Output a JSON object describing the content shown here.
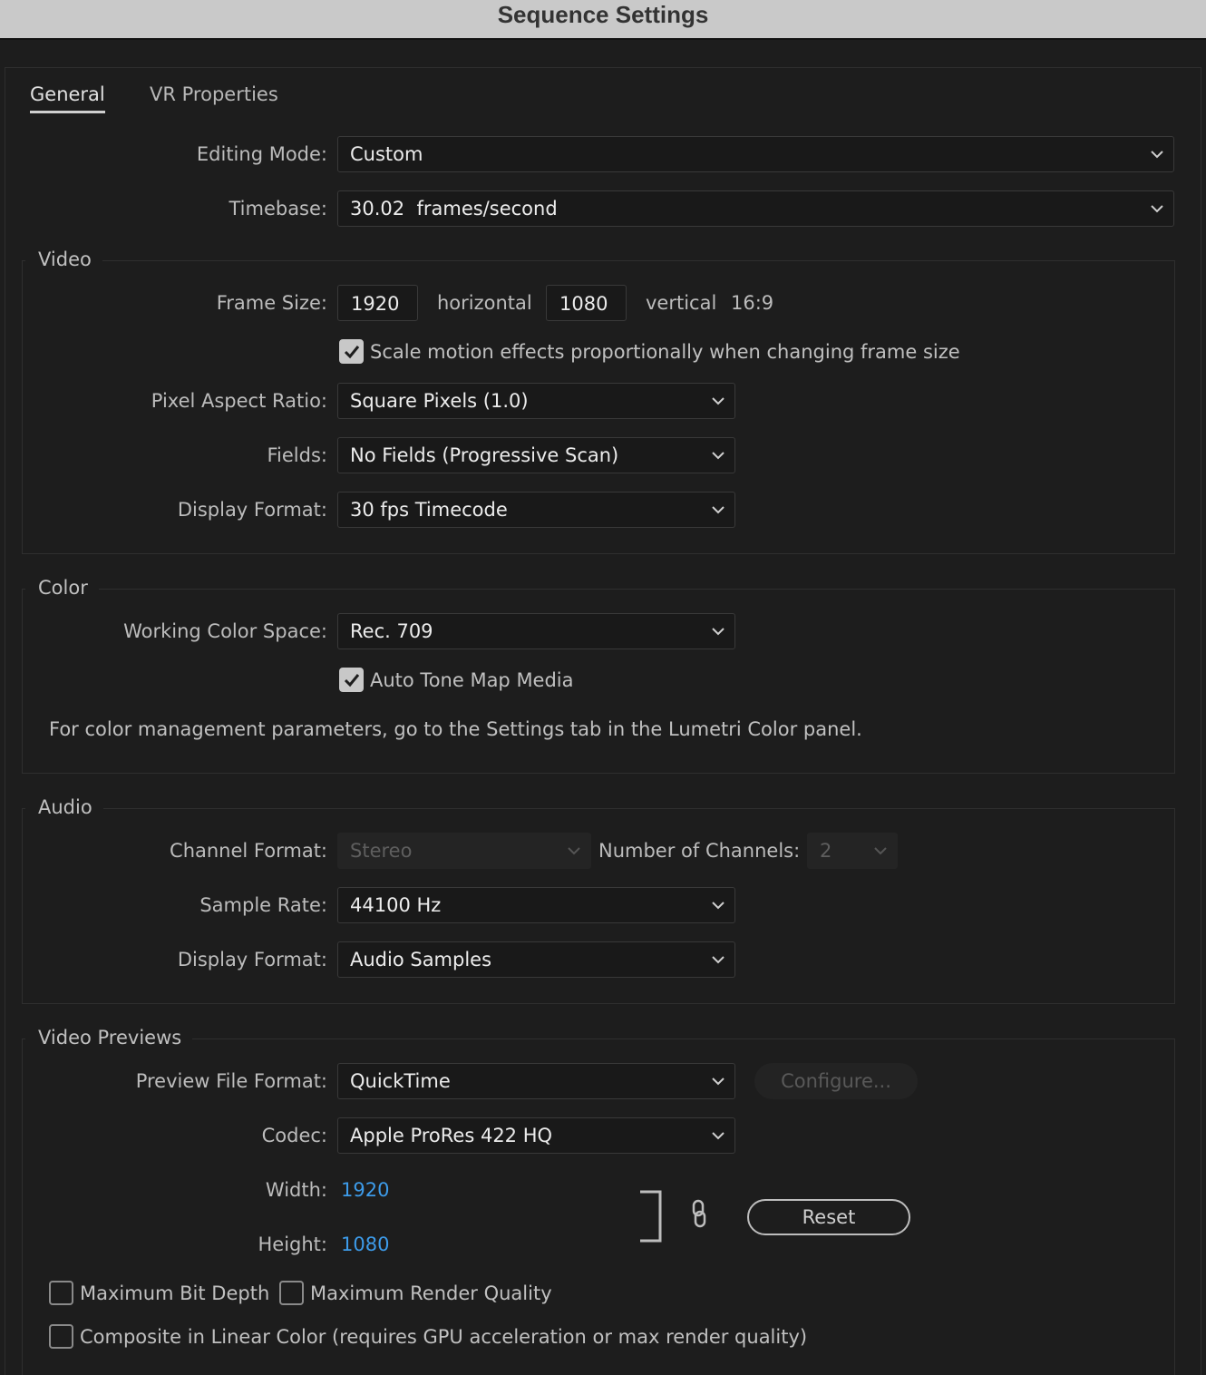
{
  "window": {
    "title": "Sequence Settings"
  },
  "tabs": [
    {
      "label": "General",
      "active": true
    },
    {
      "label": "VR Properties",
      "active": false
    }
  ],
  "general": {
    "editing_mode_label": "Editing Mode:",
    "editing_mode_value": "Custom",
    "timebase_label": "Timebase:",
    "timebase_value": "30.02  frames/second"
  },
  "video": {
    "legend": "Video",
    "frame_size_label": "Frame Size:",
    "frame_width": "1920",
    "horizontal_label": "horizontal",
    "frame_height": "1080",
    "vertical_label": "vertical",
    "aspect": "16:9",
    "scale_motion_label": "Scale motion effects proportionally when changing frame size",
    "scale_motion_checked": true,
    "par_label": "Pixel Aspect Ratio:",
    "par_value": "Square Pixels (1.0)",
    "fields_label": "Fields:",
    "fields_value": "No Fields (Progressive Scan)",
    "display_format_label": "Display Format:",
    "display_format_value": "30 fps Timecode"
  },
  "color": {
    "legend": "Color",
    "working_space_label": "Working Color Space:",
    "working_space_value": "Rec. 709",
    "auto_tone_label": "Auto Tone Map Media",
    "auto_tone_checked": true,
    "note": "For color management parameters, go to the Settings tab in the Lumetri Color panel."
  },
  "audio": {
    "legend": "Audio",
    "channel_format_label": "Channel Format:",
    "channel_format_value": "Stereo",
    "num_channels_label": "Number of Channels:",
    "num_channels_value": "2",
    "sample_rate_label": "Sample Rate:",
    "sample_rate_value": "44100 Hz",
    "display_format_label": "Display Format:",
    "display_format_value": "Audio Samples"
  },
  "previews": {
    "legend": "Video Previews",
    "file_format_label": "Preview File Format:",
    "file_format_value": "QuickTime",
    "configure_label": "Configure...",
    "codec_label": "Codec:",
    "codec_value": "Apple ProRes 422 HQ",
    "width_label": "Width:",
    "width_value": "1920",
    "height_label": "Height:",
    "height_value": "1080",
    "reset_label": "Reset",
    "max_bit_depth_label": "Maximum Bit Depth",
    "max_bit_depth_checked": false,
    "max_render_label": "Maximum Render Quality",
    "max_render_checked": false,
    "linear_color_label": "Composite in Linear Color (requires GPU acceleration or max render quality)",
    "linear_color_checked": false
  },
  "colors": {
    "accent_link": "#3d9be9",
    "background": "#1d1d1d",
    "titlebar": "#c9c9c9"
  }
}
